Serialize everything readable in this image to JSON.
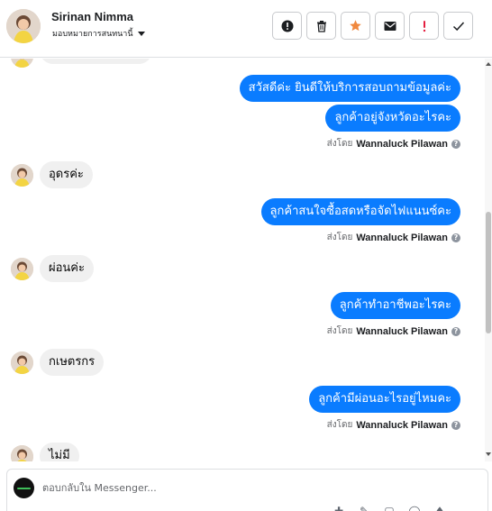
{
  "header": {
    "contact_name": "Sirinan Nimma",
    "assign_label": "มอบหมายการสนทนานี้",
    "actions": [
      {
        "name": "mark-spam-button",
        "icon": "alert-circle-icon"
      },
      {
        "name": "delete-button",
        "icon": "trash-icon"
      },
      {
        "name": "star-button",
        "icon": "star-icon",
        "color": "#f0883e"
      },
      {
        "name": "mark-unread-button",
        "icon": "envelope-icon"
      },
      {
        "name": "follow-up-button",
        "icon": "exclamation-icon",
        "color": "#e41e3f"
      },
      {
        "name": "mark-done-button",
        "icon": "check-icon"
      }
    ]
  },
  "messages": {
    "m1_out": "สวัสดีค่ะ  ยินดีให้บริการสอบถามข้อมูลค่ะ",
    "m2_out": "ลูกค้าอยู่จังหวัดอะไรคะ",
    "m3_in": "อุดรค่ะ",
    "m4_out": "ลูกค้าสนใจซื้อสดหรือจัดไฟแนนซ์คะ",
    "m5_in": "ผ่อนค่ะ",
    "m6_out": "ลูกค้าทำอาชีพอะไรคะ",
    "m7_in": "กเษตรกร",
    "m8_out": "ลูกค้ามีผ่อนอะไรอยู่ไหมคะ",
    "m9_in": "ไม่มี"
  },
  "sent_by": {
    "prefix": "ส่งโดย",
    "agent": "Wannaluck Pilawan",
    "help": "?"
  },
  "composer": {
    "placeholder": "ตอบกลับใน Messenger..."
  },
  "colors": {
    "outgoing_bubble": "#0a7cff",
    "incoming_bubble": "#f0f0f0"
  }
}
